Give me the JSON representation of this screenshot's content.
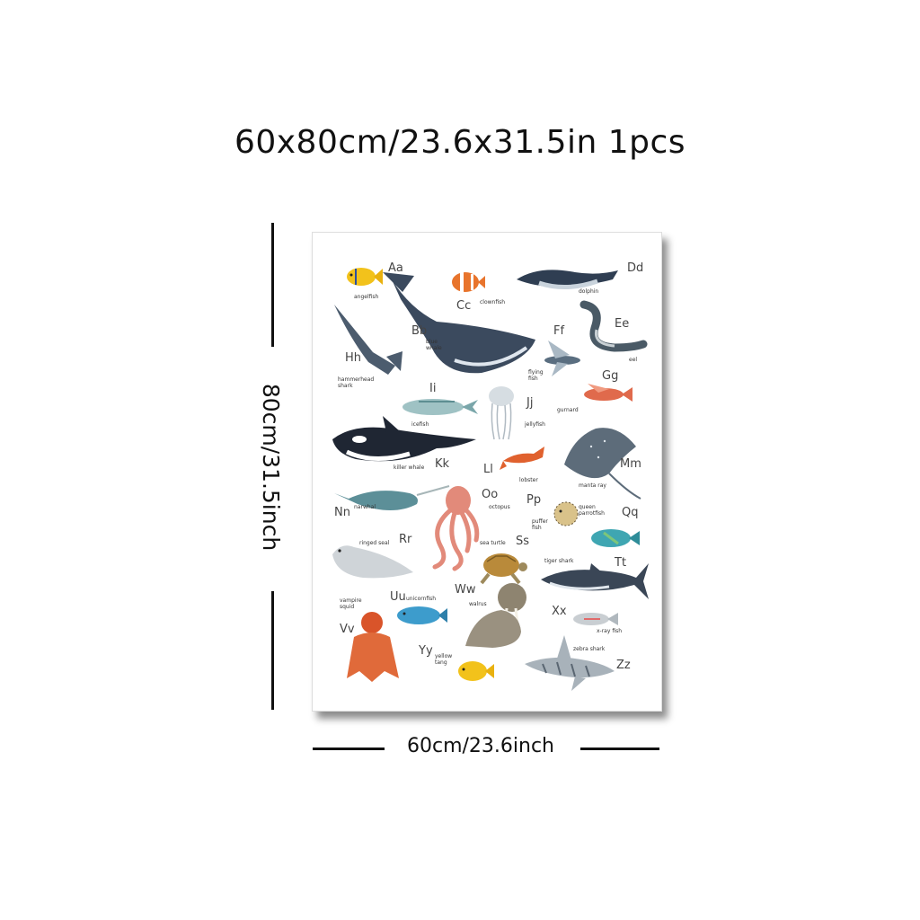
{
  "title": "60x80cm/23.6x31.5in 1pcs",
  "height_label": "80cm/31.5inch",
  "width_label": "60cm/23.6inch",
  "poster": {
    "entries": [
      {
        "letter": "Aa",
        "name": "angelfish"
      },
      {
        "letter": "Bb",
        "name": "blue whale"
      },
      {
        "letter": "Cc",
        "name": "clownfish"
      },
      {
        "letter": "Dd",
        "name": "dolphin"
      },
      {
        "letter": "Ee",
        "name": "eel"
      },
      {
        "letter": "Ff",
        "name": "flying fish"
      },
      {
        "letter": "Gg",
        "name": "gurnard"
      },
      {
        "letter": "Hh",
        "name": "hammerhead shark"
      },
      {
        "letter": "Ii",
        "name": "icefish"
      },
      {
        "letter": "Jj",
        "name": "jellyfish"
      },
      {
        "letter": "Kk",
        "name": "killer whale"
      },
      {
        "letter": "Ll",
        "name": "lobster"
      },
      {
        "letter": "Mm",
        "name": "manta ray"
      },
      {
        "letter": "Nn",
        "name": "narwhal"
      },
      {
        "letter": "Oo",
        "name": "octopus"
      },
      {
        "letter": "Pp",
        "name": "puffer fish"
      },
      {
        "letter": "Qq",
        "name": "queen parrotfish"
      },
      {
        "letter": "Rr",
        "name": "ringed seal"
      },
      {
        "letter": "Ss",
        "name": "sea turtle"
      },
      {
        "letter": "Tt",
        "name": "tiger shark"
      },
      {
        "letter": "Uu",
        "name": "unicornfish"
      },
      {
        "letter": "Vv",
        "name": "vampire squid"
      },
      {
        "letter": "Ww",
        "name": "walrus"
      },
      {
        "letter": "Xx",
        "name": "x-ray fish"
      },
      {
        "letter": "Yy",
        "name": "yellow tang"
      },
      {
        "letter": "Zz",
        "name": "zebra shark"
      }
    ]
  },
  "colors": {
    "ink": "#111111",
    "whale": "#3b4a5e",
    "orange": "#e8742c",
    "yellow": "#f2c21b",
    "pink": "#e28a7a"
  }
}
